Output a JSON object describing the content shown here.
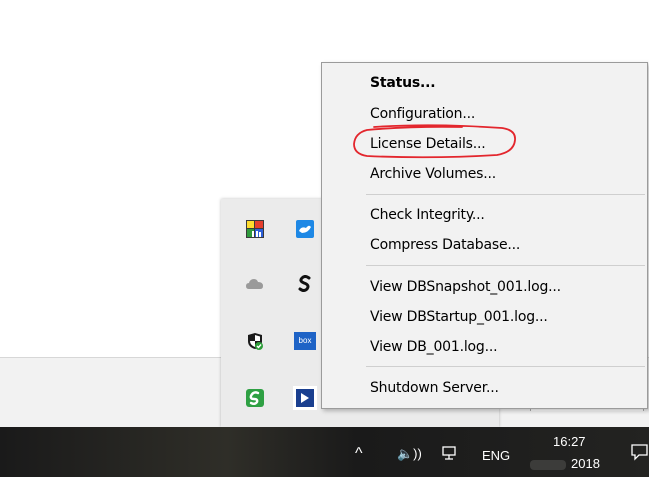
{
  "menu": {
    "items": [
      {
        "label": "Status...",
        "bold": true
      },
      {
        "label": "Configuration..."
      },
      {
        "label": "License Details...",
        "highlighted": true
      },
      {
        "label": "Archive Volumes..."
      },
      {
        "label": "Check Integrity..."
      },
      {
        "label": "Compress Database..."
      },
      {
        "label": "View DBSnapshot_001.log..."
      },
      {
        "label": "View DBStartup_001.log..."
      },
      {
        "label": "View DB_001.log..."
      },
      {
        "label": "Shutdown Server..."
      }
    ]
  },
  "tray_flyout": {
    "icons": [
      "colorful-app-icon",
      "blue-cloud-app-icon",
      "onedrive-icon",
      "s-app-icon",
      "windows-defender-icon",
      "box-sync-icon",
      "green-sync-icon",
      "database-server-icon"
    ],
    "box_label": "box"
  },
  "taskbar": {
    "chevron": "^",
    "volume": "🔈))",
    "language": "ENG",
    "time": "16:27",
    "year": "2018"
  },
  "colors": {
    "annotation_red": "#e3262d",
    "menu_bg": "#f2f2f2",
    "taskbar_bg": "#1f1f1f"
  }
}
